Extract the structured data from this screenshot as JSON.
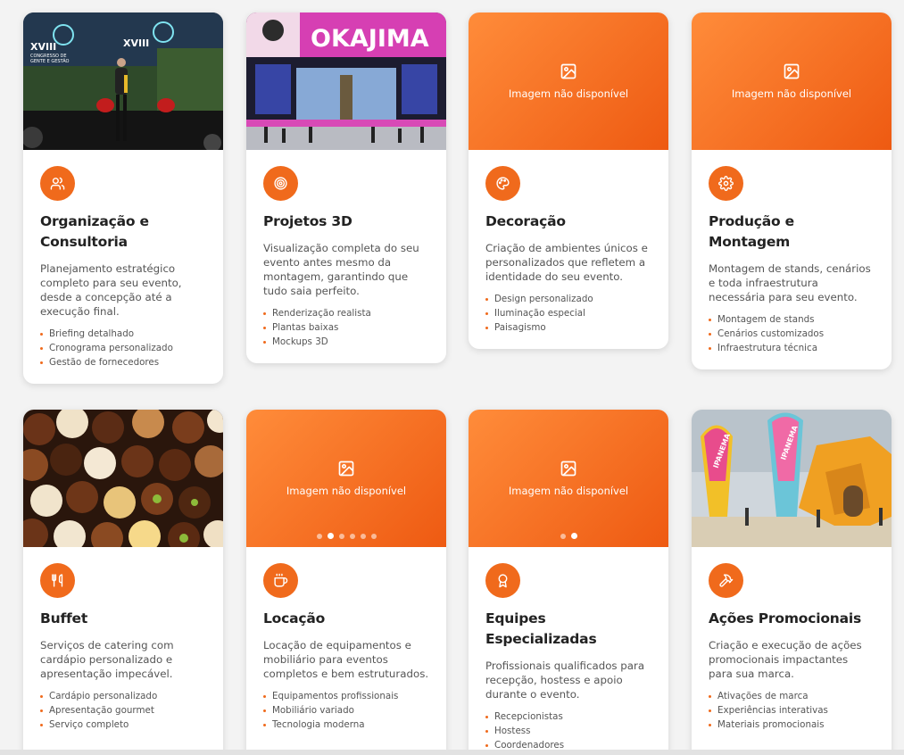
{
  "placeholder_text": "Imagem não disponível",
  "colors": {
    "accent": "#f06a1c",
    "gradient_start": "#ff8c3a",
    "gradient_end": "#ee5a12"
  },
  "cards": [
    {
      "id": "organizacao",
      "title_lines": [
        "Organização e",
        "Consultoria"
      ],
      "icon": "users-icon",
      "media": {
        "kind": "photo",
        "photo_text": [
          "XVIII",
          "CONGRESSO DE",
          "GENTE E GESTÃO"
        ]
      },
      "description": "Planejamento estratégico completo para seu evento, desde a concepção até a execução final.",
      "items": [
        "Briefing detalhado",
        "Cronograma personalizado",
        "Gestão de fornecedores"
      ]
    },
    {
      "id": "projetos-3d",
      "title_lines": [
        "Projetos 3D"
      ],
      "icon": "target-icon",
      "media": {
        "kind": "photo",
        "photo_text": [
          "OKAJIMA"
        ]
      },
      "description": "Visualização completa do seu evento antes mesmo da montagem, garantindo que tudo saia perfeito.",
      "items": [
        "Renderização realista",
        "Plantas baixas",
        "Mockups 3D"
      ]
    },
    {
      "id": "decoracao",
      "title_lines": [
        "Decoração"
      ],
      "icon": "palette-icon",
      "media": {
        "kind": "placeholder"
      },
      "description": "Criação de ambientes únicos e personalizados que refletem a identidade do seu evento.",
      "items": [
        "Design personalizado",
        "Iluminação especial",
        "Paisagismo"
      ]
    },
    {
      "id": "producao",
      "title_lines": [
        "Produção e",
        "Montagem"
      ],
      "icon": "gear-icon",
      "media": {
        "kind": "placeholder"
      },
      "description": "Montagem de stands, cenários e toda infraestrutura necessária para seu evento.",
      "items": [
        "Montagem de stands",
        "Cenários customizados",
        "Infraestrutura técnica"
      ]
    },
    {
      "id": "buffet",
      "title_lines": [
        "Buffet"
      ],
      "icon": "utensils-icon",
      "media": {
        "kind": "photo"
      },
      "description": "Serviços de catering com cardápio personalizado e apresentação impecável.",
      "items": [
        "Cardápio personalizado",
        "Apresentação gourmet",
        "Serviço completo"
      ]
    },
    {
      "id": "locacao",
      "title_lines": [
        "Locação"
      ],
      "icon": "cup-icon",
      "media": {
        "kind": "placeholder",
        "dots": 6,
        "active_dot": 1
      },
      "description": "Locação de equipamentos e mobiliário para eventos completos e bem estruturados.",
      "items": [
        "Equipamentos profissionais",
        "Mobiliário variado",
        "Tecnologia moderna"
      ]
    },
    {
      "id": "equipes",
      "title_lines": [
        "Equipes",
        "Especializadas"
      ],
      "icon": "award-icon",
      "media": {
        "kind": "placeholder",
        "dots": 2,
        "active_dot": 1
      },
      "description": "Profissionais qualificados para recepção, hostess e apoio durante o evento.",
      "items": [
        "Recepcionistas",
        "Hostess",
        "Coordenadores"
      ]
    },
    {
      "id": "acoes",
      "title_lines": [
        "Ações Promocionais"
      ],
      "icon": "hammer-icon",
      "media": {
        "kind": "photo",
        "photo_text": [
          "IPANEMA",
          "IPANEMA"
        ]
      },
      "description": "Criação e execução de ações promocionais impactantes para sua marca.",
      "items": [
        "Ativações de marca",
        "Experiências interativas",
        "Materiais promocionais"
      ]
    }
  ]
}
